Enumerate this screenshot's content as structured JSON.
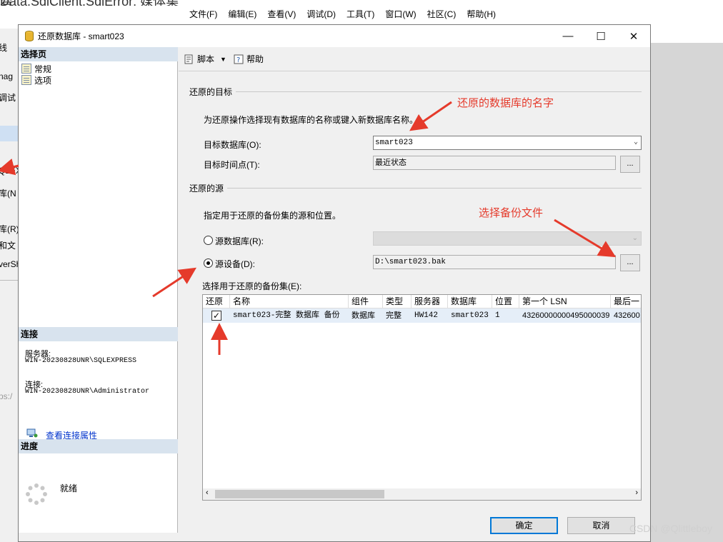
{
  "background": {
    "title_fragment": "Data.SqlClient.SqlError: 媒体集有",
    "menu": [
      "文件(F)",
      "编辑(E)",
      "查看(V)",
      "调试(D)",
      "工具(T)",
      "窗口(W)",
      "社区(C)",
      "帮助(H)"
    ],
    "left_fragments": [
      "线",
      "nag",
      "调试",
      "QLEX",
      "库(N",
      "库(R)",
      "和文",
      "verSh",
      "ps:/"
    ]
  },
  "dialog": {
    "title": "还原数据库 - smart023",
    "left": {
      "select_page_header": "选择页",
      "pages": [
        "常规",
        "选项"
      ],
      "connection_header": "连接",
      "server_label": "服务器:",
      "server_value": "WIN-20230828UNR\\SQLEXPRESS",
      "connection_label": "连接:",
      "connection_value": "WIN-20230828UNR\\Administrator",
      "view_connection_link": "查看连接属性",
      "progress_header": "进度",
      "progress_status": "就绪"
    },
    "toolbar": {
      "script": "脚本",
      "help": "帮助"
    },
    "target_group": {
      "heading": "还原的目标",
      "description": "为还原操作选择现有数据库的名称或键入新数据库名称。",
      "target_db_label": "目标数据库(O):",
      "target_db_value": "smart023",
      "target_time_label": "目标时间点(T):",
      "target_time_value": "最近状态",
      "browse": "..."
    },
    "source_group": {
      "heading": "还原的源",
      "description": "指定用于还原的备份集的源和位置。",
      "source_db_label": "源数据库(R):",
      "source_device_label": "源设备(D):",
      "source_device_value": "D:\\smart023.bak",
      "browse": "..."
    },
    "backupset": {
      "label": "选择用于还原的备份集(E):",
      "columns": [
        "还原",
        "名称",
        "组件",
        "类型",
        "服务器",
        "数据库",
        "位置",
        "第一个 LSN",
        "最后一"
      ],
      "rows": [
        {
          "restore": true,
          "name": "smart023-完整 数据库 备份",
          "component": "数据库",
          "type": "完整",
          "server": "HW142",
          "database": "smart023",
          "position": "1",
          "first_lsn": "43260000000495000039",
          "last_lsn": "432600"
        }
      ]
    },
    "buttons": {
      "ok": "确定",
      "cancel": "取消"
    }
  },
  "annotations": {
    "db_name": "还原的数据库的名字",
    "select_file": "选择备份文件",
    "color": "#e53a2b"
  },
  "watermark": "CSDN @Qlittleboy"
}
